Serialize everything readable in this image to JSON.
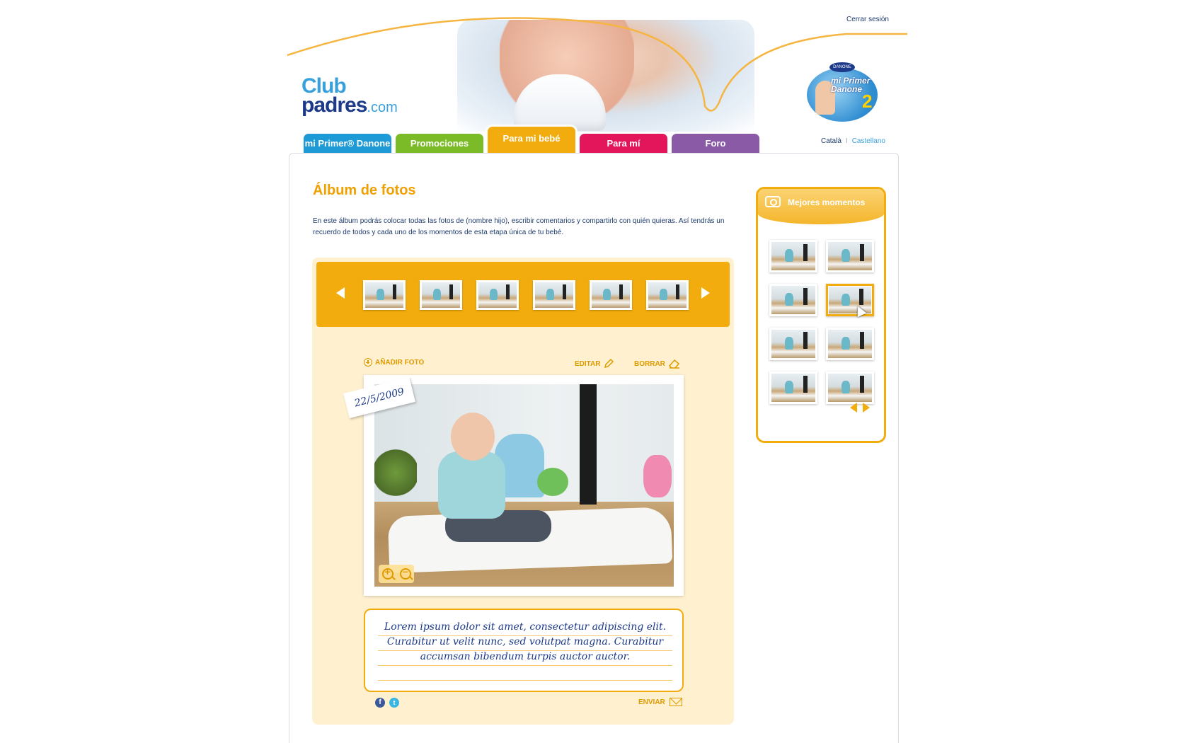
{
  "header": {
    "logout_label": "Cerrar sesión",
    "logo": {
      "line1": "Club",
      "line2": "padres",
      "suffix": ".com"
    },
    "badge": {
      "brand": "DANONE",
      "text": "mi Primer Danone",
      "number": "2"
    }
  },
  "nav": {
    "tabs": [
      {
        "label": "mi Primer® Danone",
        "color": "#1e9ad6",
        "active": false
      },
      {
        "label": "Promociones",
        "color": "#7cbb28",
        "active": false
      },
      {
        "label": "Para mi bebé",
        "color": "#f2ac0e",
        "active": true
      },
      {
        "label": "Para mí",
        "color": "#e3165b",
        "active": false
      },
      {
        "label": "Foro",
        "color": "#8a5aa6",
        "active": false
      }
    ],
    "languages": {
      "catalan": "Català",
      "separator": "I",
      "spanish": "Castellano"
    }
  },
  "main": {
    "title": "Álbum de fotos",
    "intro": "En este álbum podrás colocar todas las fotos de (nombre hijo), escribir comentarios y compartirlo con quién quieras. Así tendrás un recuerdo de todos y cada uno de los momentos de esta etapa única de tu bebé.",
    "actions": {
      "add": "AÑADIR FOTO",
      "edit": "EDITAR",
      "delete": "BORRAR",
      "send": "ENVIAR"
    },
    "photo": {
      "date": "22/5/2009"
    },
    "comment": "Lorem ipsum dolor sit amet, consectetur adipiscing elit. Curabitur ut velit nunc, sed volutpat magna. Curabitur accumsan bibendum turpis auctor auctor.",
    "social": {
      "facebook": "f",
      "twitter": "t"
    }
  },
  "sidebar": {
    "title": "Mejores momentos"
  },
  "colors": {
    "accent": "#f2ac0e",
    "title": "#f0a000",
    "text": "#1d3a6b",
    "album_bg": "#fff1d0"
  }
}
